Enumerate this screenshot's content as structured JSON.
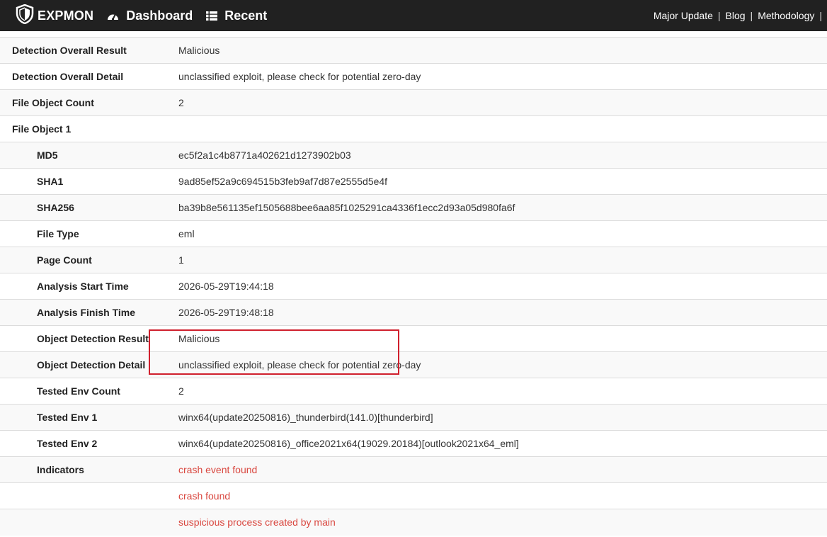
{
  "nav": {
    "brand": "EXPMON",
    "dashboard": "Dashboard",
    "recent": "Recent",
    "links": [
      "Major Update",
      "Blog",
      "Methodology"
    ],
    "separator": "|"
  },
  "rows": [
    {
      "key": "Detection Overall Result",
      "value": "Malicious"
    },
    {
      "key": "Detection Overall Detail",
      "value": "unclassified exploit, please check for potential zero-day"
    },
    {
      "key": "File Object Count",
      "value": "2"
    },
    {
      "key": "File Object 1",
      "value": ""
    },
    {
      "key": "MD5",
      "value": "ec5f2a1c4b8771a402621d1273902b03"
    },
    {
      "key": "SHA1",
      "value": "9ad85ef52a9c694515b3feb9af7d87e2555d5e4f"
    },
    {
      "key": "SHA256",
      "value": "ba39b8e561135ef1505688bee6aa85f1025291ca4336f1ecc2d93a05d980fa6f"
    },
    {
      "key": "File Type",
      "value": "eml"
    },
    {
      "key": "Page Count",
      "value": "1"
    },
    {
      "key": "Analysis Start Time",
      "value": "2026-05-29T19:44:18"
    },
    {
      "key": "Analysis Finish Time",
      "value": "2026-05-29T19:48:18"
    },
    {
      "key": "Object Detection Result",
      "value": "Malicious"
    },
    {
      "key": "Object Detection Detail",
      "value": "unclassified exploit, please check for potential zero-day"
    },
    {
      "key": "Tested Env Count",
      "value": "2"
    },
    {
      "key": "Tested Env 1",
      "value": "winx64(update20250816)_thunderbird(141.0)[thunderbird]"
    },
    {
      "key": "Tested Env 2",
      "value": "winx64(update20250816)_office2021x64(19029.20184)[outlook2021x64_eml]"
    },
    {
      "key": "Indicators",
      "value": "crash event found"
    },
    {
      "key": "",
      "value": "crash found"
    },
    {
      "key": "",
      "value": "suspicious process created by main"
    }
  ],
  "colors": {
    "indicator": "#d9473f",
    "highlight_box": "#d0202d",
    "topbar": "#212121"
  }
}
